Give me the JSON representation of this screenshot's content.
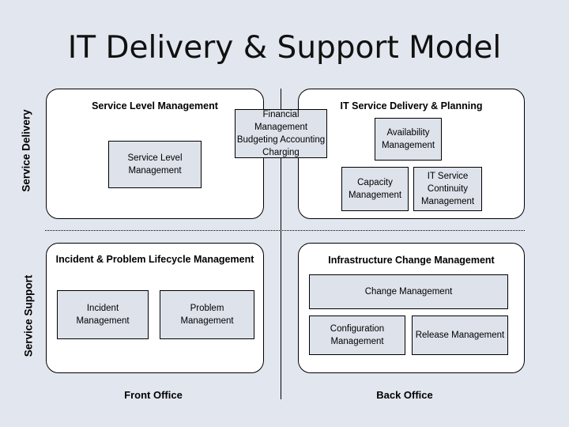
{
  "slide": {
    "title": "IT Delivery & Support Model",
    "background_color": "#e2e7ef",
    "box_fill_color": "#dde2eb",
    "container_fill_color": "#ffffff",
    "line_color": "#000000"
  },
  "axis_labels": {
    "vertical": [
      {
        "id": "service-delivery",
        "text": "Service Delivery"
      },
      {
        "id": "service-support",
        "text": "Service Support"
      }
    ],
    "horizontal": [
      {
        "id": "front-office",
        "text": "Front Office"
      },
      {
        "id": "back-office",
        "text": "Back Office"
      }
    ]
  },
  "quadrants": {
    "top_left": {
      "title": "Service Level Management",
      "boxes": [
        {
          "id": "service-level-management",
          "label": "Service Level Management"
        }
      ]
    },
    "top_right": {
      "title": "IT Service Delivery & Planning",
      "boxes": [
        {
          "id": "availability-management",
          "label": "Availability Management"
        },
        {
          "id": "capacity-management",
          "label": "Capacity Management"
        },
        {
          "id": "it-service-continuity-management",
          "label": "IT Service Continuity Management"
        }
      ]
    },
    "bottom_left": {
      "title": "Incident & Problem Lifecycle Management",
      "boxes": [
        {
          "id": "incident-management",
          "label": "Incident Management"
        },
        {
          "id": "problem-management",
          "label": "Problem Management"
        }
      ]
    },
    "bottom_right": {
      "title": "Infrastructure Change Management",
      "boxes": [
        {
          "id": "change-management",
          "label": "Change Management"
        },
        {
          "id": "configuration-management",
          "label": "Configuration Management"
        },
        {
          "id": "release-management",
          "label": "Release Management"
        }
      ]
    }
  },
  "floating_box": {
    "id": "financial-management",
    "label": "Financial Management",
    "subtitle": "Budgeting Accounting Charging"
  }
}
